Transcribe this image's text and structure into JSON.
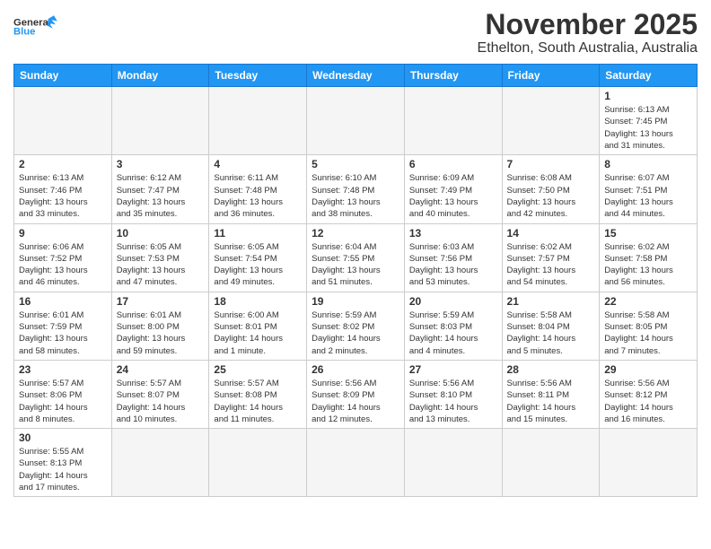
{
  "header": {
    "logo_line1": "General",
    "logo_line2": "Blue",
    "title": "November 2025",
    "subtitle": "Ethelton, South Australia, Australia"
  },
  "days_of_week": [
    "Sunday",
    "Monday",
    "Tuesday",
    "Wednesday",
    "Thursday",
    "Friday",
    "Saturday"
  ],
  "weeks": [
    [
      {
        "day": "",
        "info": ""
      },
      {
        "day": "",
        "info": ""
      },
      {
        "day": "",
        "info": ""
      },
      {
        "day": "",
        "info": ""
      },
      {
        "day": "",
        "info": ""
      },
      {
        "day": "",
        "info": ""
      },
      {
        "day": "1",
        "info": "Sunrise: 6:13 AM\nSunset: 7:45 PM\nDaylight: 13 hours\nand 31 minutes."
      }
    ],
    [
      {
        "day": "2",
        "info": "Sunrise: 6:13 AM\nSunset: 7:46 PM\nDaylight: 13 hours\nand 33 minutes."
      },
      {
        "day": "3",
        "info": "Sunrise: 6:12 AM\nSunset: 7:47 PM\nDaylight: 13 hours\nand 35 minutes."
      },
      {
        "day": "4",
        "info": "Sunrise: 6:11 AM\nSunset: 7:48 PM\nDaylight: 13 hours\nand 36 minutes."
      },
      {
        "day": "5",
        "info": "Sunrise: 6:10 AM\nSunset: 7:48 PM\nDaylight: 13 hours\nand 38 minutes."
      },
      {
        "day": "6",
        "info": "Sunrise: 6:09 AM\nSunset: 7:49 PM\nDaylight: 13 hours\nand 40 minutes."
      },
      {
        "day": "7",
        "info": "Sunrise: 6:08 AM\nSunset: 7:50 PM\nDaylight: 13 hours\nand 42 minutes."
      },
      {
        "day": "8",
        "info": "Sunrise: 6:07 AM\nSunset: 7:51 PM\nDaylight: 13 hours\nand 44 minutes."
      }
    ],
    [
      {
        "day": "9",
        "info": "Sunrise: 6:06 AM\nSunset: 7:52 PM\nDaylight: 13 hours\nand 46 minutes."
      },
      {
        "day": "10",
        "info": "Sunrise: 6:05 AM\nSunset: 7:53 PM\nDaylight: 13 hours\nand 47 minutes."
      },
      {
        "day": "11",
        "info": "Sunrise: 6:05 AM\nSunset: 7:54 PM\nDaylight: 13 hours\nand 49 minutes."
      },
      {
        "day": "12",
        "info": "Sunrise: 6:04 AM\nSunset: 7:55 PM\nDaylight: 13 hours\nand 51 minutes."
      },
      {
        "day": "13",
        "info": "Sunrise: 6:03 AM\nSunset: 7:56 PM\nDaylight: 13 hours\nand 53 minutes."
      },
      {
        "day": "14",
        "info": "Sunrise: 6:02 AM\nSunset: 7:57 PM\nDaylight: 13 hours\nand 54 minutes."
      },
      {
        "day": "15",
        "info": "Sunrise: 6:02 AM\nSunset: 7:58 PM\nDaylight: 13 hours\nand 56 minutes."
      }
    ],
    [
      {
        "day": "16",
        "info": "Sunrise: 6:01 AM\nSunset: 7:59 PM\nDaylight: 13 hours\nand 58 minutes."
      },
      {
        "day": "17",
        "info": "Sunrise: 6:01 AM\nSunset: 8:00 PM\nDaylight: 13 hours\nand 59 minutes."
      },
      {
        "day": "18",
        "info": "Sunrise: 6:00 AM\nSunset: 8:01 PM\nDaylight: 14 hours\nand 1 minute."
      },
      {
        "day": "19",
        "info": "Sunrise: 5:59 AM\nSunset: 8:02 PM\nDaylight: 14 hours\nand 2 minutes."
      },
      {
        "day": "20",
        "info": "Sunrise: 5:59 AM\nSunset: 8:03 PM\nDaylight: 14 hours\nand 4 minutes."
      },
      {
        "day": "21",
        "info": "Sunrise: 5:58 AM\nSunset: 8:04 PM\nDaylight: 14 hours\nand 5 minutes."
      },
      {
        "day": "22",
        "info": "Sunrise: 5:58 AM\nSunset: 8:05 PM\nDaylight: 14 hours\nand 7 minutes."
      }
    ],
    [
      {
        "day": "23",
        "info": "Sunrise: 5:57 AM\nSunset: 8:06 PM\nDaylight: 14 hours\nand 8 minutes."
      },
      {
        "day": "24",
        "info": "Sunrise: 5:57 AM\nSunset: 8:07 PM\nDaylight: 14 hours\nand 10 minutes."
      },
      {
        "day": "25",
        "info": "Sunrise: 5:57 AM\nSunset: 8:08 PM\nDaylight: 14 hours\nand 11 minutes."
      },
      {
        "day": "26",
        "info": "Sunrise: 5:56 AM\nSunset: 8:09 PM\nDaylight: 14 hours\nand 12 minutes."
      },
      {
        "day": "27",
        "info": "Sunrise: 5:56 AM\nSunset: 8:10 PM\nDaylight: 14 hours\nand 13 minutes."
      },
      {
        "day": "28",
        "info": "Sunrise: 5:56 AM\nSunset: 8:11 PM\nDaylight: 14 hours\nand 15 minutes."
      },
      {
        "day": "29",
        "info": "Sunrise: 5:56 AM\nSunset: 8:12 PM\nDaylight: 14 hours\nand 16 minutes."
      }
    ],
    [
      {
        "day": "30",
        "info": "Sunrise: 5:55 AM\nSunset: 8:13 PM\nDaylight: 14 hours\nand 17 minutes."
      },
      {
        "day": "",
        "info": ""
      },
      {
        "day": "",
        "info": ""
      },
      {
        "day": "",
        "info": ""
      },
      {
        "day": "",
        "info": ""
      },
      {
        "day": "",
        "info": ""
      },
      {
        "day": "",
        "info": ""
      }
    ]
  ]
}
